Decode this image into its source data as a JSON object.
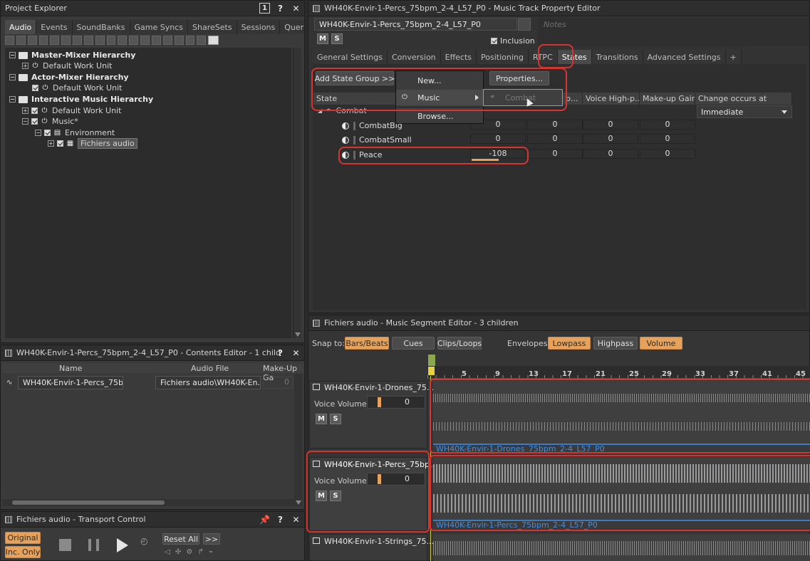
{
  "project_explorer": {
    "title": "Project Explorer",
    "tabs": [
      "Audio",
      "Events",
      "SoundBanks",
      "Game Syncs",
      "ShareSets",
      "Sessions",
      "Queries"
    ],
    "tree": [
      {
        "label": "Master-Mixer Hierarchy"
      },
      {
        "label": "Default Work Unit"
      },
      {
        "label": "Actor-Mixer Hierarchy"
      },
      {
        "label": "Default Work Unit"
      },
      {
        "label": "Interactive Music Hierarchy"
      },
      {
        "label": "Default Work Unit"
      },
      {
        "label": "Music*"
      },
      {
        "label": "Environment"
      },
      {
        "label": "Fichiers audio"
      }
    ]
  },
  "contents_editor": {
    "title": "WH40K-Envir-1-Percs_75bpm_2-4_L57_P0 - Contents Editor - 1 child",
    "columns": [
      "Name",
      "Audio File",
      "Make-Up Ga"
    ],
    "row": {
      "name": "WH40K-Envir-1-Percs_75bp",
      "audio_file": "Fichiers audio\\WH40K-En...",
      "makeup": "0"
    }
  },
  "transport": {
    "title": "Fichiers audio - Transport Control",
    "original": "Original",
    "inc_only": "Inc. Only",
    "reset_all": "Reset All",
    "more": ">>"
  },
  "property_editor": {
    "title": "WH40K-Envir-1-Percs_75bpm_2-4_L57_P0 - Music Track Property Editor",
    "name_field": "WH40K-Envir-1-Percs_75bpm_2-4_L57_P0",
    "notes_placeholder": "Notes",
    "m": "M",
    "s": "S",
    "inclusion": "Inclusion",
    "tabs": [
      "General Settings",
      "Conversion",
      "Effects",
      "Positioning",
      "RTPC",
      "States",
      "Transitions",
      "Advanced Settings",
      "+"
    ],
    "add_state_group": "Add State Group >>",
    "properties": "Properties...",
    "menu": {
      "new": "New...",
      "music": "Music",
      "browse": "Browse...",
      "submenu": "Combat"
    },
    "columns": [
      "State",
      "p...",
      "Voice High-p...",
      "Make-up Gain",
      "Change occurs at"
    ],
    "group": "Combat",
    "change_occurs": "Immediate",
    "states": [
      {
        "name": "CombatBig",
        "values": [
          "0",
          "0",
          "0",
          "0"
        ]
      },
      {
        "name": "CombatSmall",
        "values": [
          "0",
          "0",
          "0",
          "0"
        ]
      },
      {
        "name": "Peace",
        "values": [
          "-108",
          "0",
          "0",
          "0"
        ]
      }
    ]
  },
  "segment_editor": {
    "title": "Fichiers audio - Music Segment Editor - 3 children",
    "snap_label": "Snap to:",
    "snap": [
      "Bars/Beats",
      "Cues",
      "Clips/Loops"
    ],
    "env_label": "Envelopes:",
    "envelopes": [
      "Lowpass",
      "Highpass",
      "Volume"
    ],
    "ruler": [
      "5",
      "9",
      "13",
      "17",
      "21",
      "25",
      "29",
      "33",
      "37",
      "41",
      "45"
    ],
    "tracks": [
      {
        "name": "WH40K-Envir-1-Drones_75...",
        "voice": "Voice Volume",
        "value": "0",
        "clip": "WH40K-Envir-1-Drones_75bpm_2-4_L57_P0"
      },
      {
        "name": "WH40K-Envir-1-Percs_75bp...",
        "voice": "Voice Volume",
        "value": "0",
        "clip": "WH40K-Envir-1-Percs_75bpm_2-4_L57_P0"
      },
      {
        "name": "WH40K-Envir-1-Strings_75...",
        "voice": "",
        "value": "",
        "clip": ""
      }
    ]
  },
  "colors": {
    "accent": "#e6a25a",
    "highlight": "#d8332f",
    "clip": "#3e8fe6"
  }
}
